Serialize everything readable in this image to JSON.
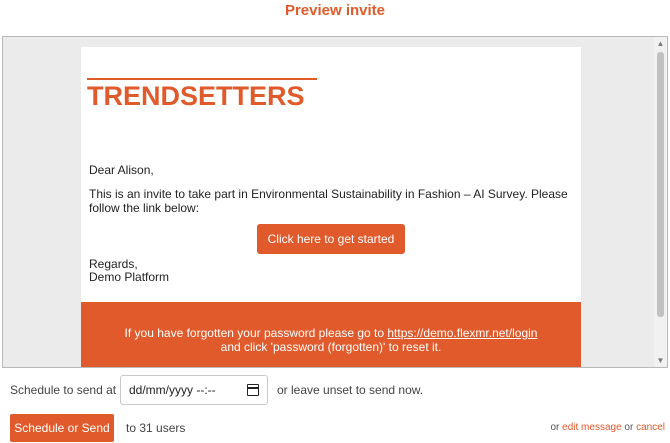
{
  "page": {
    "title": "Preview invite"
  },
  "email": {
    "logo_text": "TRENDSETTERS",
    "greeting": "Dear Alison,",
    "invite_text": "This is an invite to take part in Environmental Sustainability in Fashion – AI Survey. Please follow the link below:",
    "cta_label": "Click here to get started",
    "regards": "Regards,",
    "signature": "Demo Platform",
    "footer": {
      "line1_prefix": "If you have forgotten your password please go to ",
      "link": "https://demo.flexmr.net/login",
      "line2": "and click 'password (forgotten)' to reset it."
    }
  },
  "schedule": {
    "label": "Schedule to send at",
    "date_placeholder": "dd/mm/yyyy --:--",
    "hint": "or leave unset to send now."
  },
  "send": {
    "button_label": "Schedule or Send",
    "recipients": "to 31 users",
    "or1": "or ",
    "edit_label": "edit message",
    "or2": " or ",
    "cancel_label": "cancel"
  },
  "colors": {
    "accent": "#e05a2b"
  }
}
